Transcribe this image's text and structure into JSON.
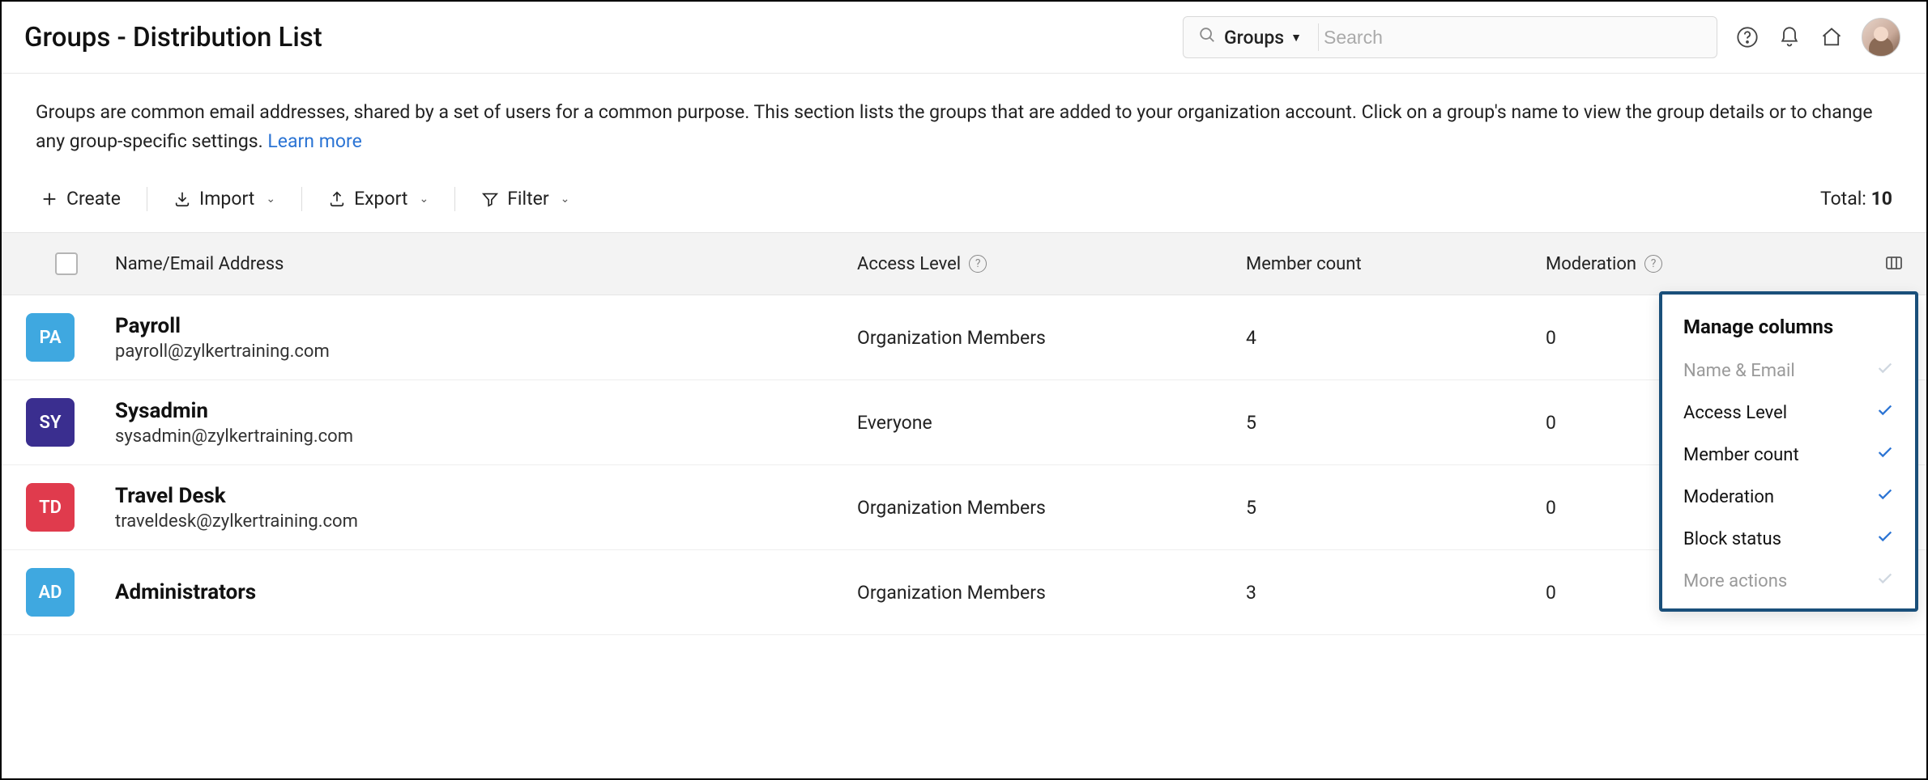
{
  "header": {
    "title": "Groups - Distribution List",
    "search": {
      "scope_label": "Groups",
      "placeholder": "Search"
    }
  },
  "intro": {
    "text": "Groups are common email addresses, shared by a set of users for a common purpose. This section lists the groups that are added to your organization account. Click on a group's name to view the group details or to change any group-specific settings. ",
    "learn_more_label": "Learn more"
  },
  "toolbar": {
    "create_label": "Create",
    "import_label": "Import",
    "export_label": "Export",
    "filter_label": "Filter",
    "total_prefix": "Total: ",
    "total_value": "10"
  },
  "columns": {
    "name_email": "Name/Email Address",
    "access_level": "Access Level",
    "member_count": "Member count",
    "moderation": "Moderation"
  },
  "rows": [
    {
      "initials": "PA",
      "color": "#3fa8e0",
      "name": "Payroll",
      "email": "payroll@zylkertraining.com",
      "access": "Organization Members",
      "members": "4",
      "moderation": "0"
    },
    {
      "initials": "SY",
      "color": "#3a2e8f",
      "name": "Sysadmin",
      "email": "sysadmin@zylkertraining.com",
      "access": "Everyone",
      "members": "5",
      "moderation": "0"
    },
    {
      "initials": "TD",
      "color": "#e03b4d",
      "name": "Travel Desk",
      "email": "traveldesk@zylkertraining.com",
      "access": "Organization Members",
      "members": "5",
      "moderation": "0"
    },
    {
      "initials": "AD",
      "color": "#3fa8e0",
      "name": "Administrators",
      "email": "",
      "access": "Organization Members",
      "members": "3",
      "moderation": "0"
    }
  ],
  "popover": {
    "title": "Manage columns",
    "items": [
      {
        "label": "Name & Email",
        "checked": true,
        "disabled": true
      },
      {
        "label": "Access Level",
        "checked": true,
        "disabled": false
      },
      {
        "label": "Member count",
        "checked": true,
        "disabled": false
      },
      {
        "label": "Moderation",
        "checked": true,
        "disabled": false
      },
      {
        "label": "Block status",
        "checked": true,
        "disabled": false
      },
      {
        "label": "More actions",
        "checked": true,
        "disabled": true
      }
    ]
  }
}
